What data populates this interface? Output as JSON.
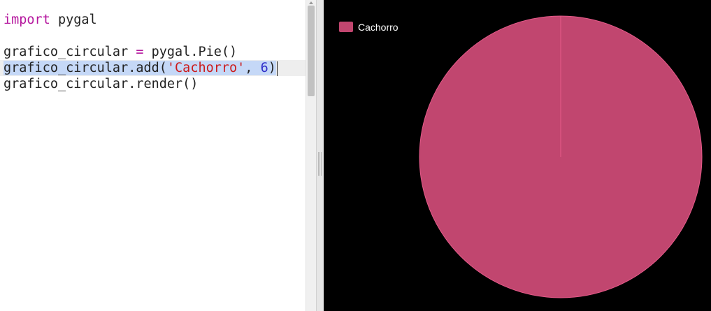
{
  "editor": {
    "lines": [
      {
        "tokens": [
          {
            "text": "import",
            "cls": "tok-kw"
          },
          {
            "text": " pygal",
            "cls": ""
          }
        ]
      },
      {
        "tokens": []
      },
      {
        "tokens": [
          {
            "text": "grafico_circular ",
            "cls": ""
          },
          {
            "text": "=",
            "cls": "tok-op"
          },
          {
            "text": " pygal.Pie()",
            "cls": ""
          }
        ]
      },
      {
        "tokens": [
          {
            "text": "grafico_circular.add(",
            "cls": ""
          },
          {
            "text": "'Cachorro'",
            "cls": "tok-str"
          },
          {
            "text": ", ",
            "cls": ""
          },
          {
            "text": "6",
            "cls": "tok-num"
          },
          {
            "text": ")",
            "cls": ""
          }
        ],
        "active": true,
        "selected": true
      },
      {
        "tokens": [
          {
            "text": "grafico_circular.render()",
            "cls": ""
          }
        ]
      }
    ]
  },
  "chart_data": {
    "type": "pie",
    "series": [
      {
        "name": "Cachorro",
        "values": [
          6
        ]
      }
    ],
    "legend_position": "top-left",
    "colors": {
      "Cachorro": "#c1466f",
      "background": "#000000",
      "slice_border": "#e65a8a"
    }
  }
}
